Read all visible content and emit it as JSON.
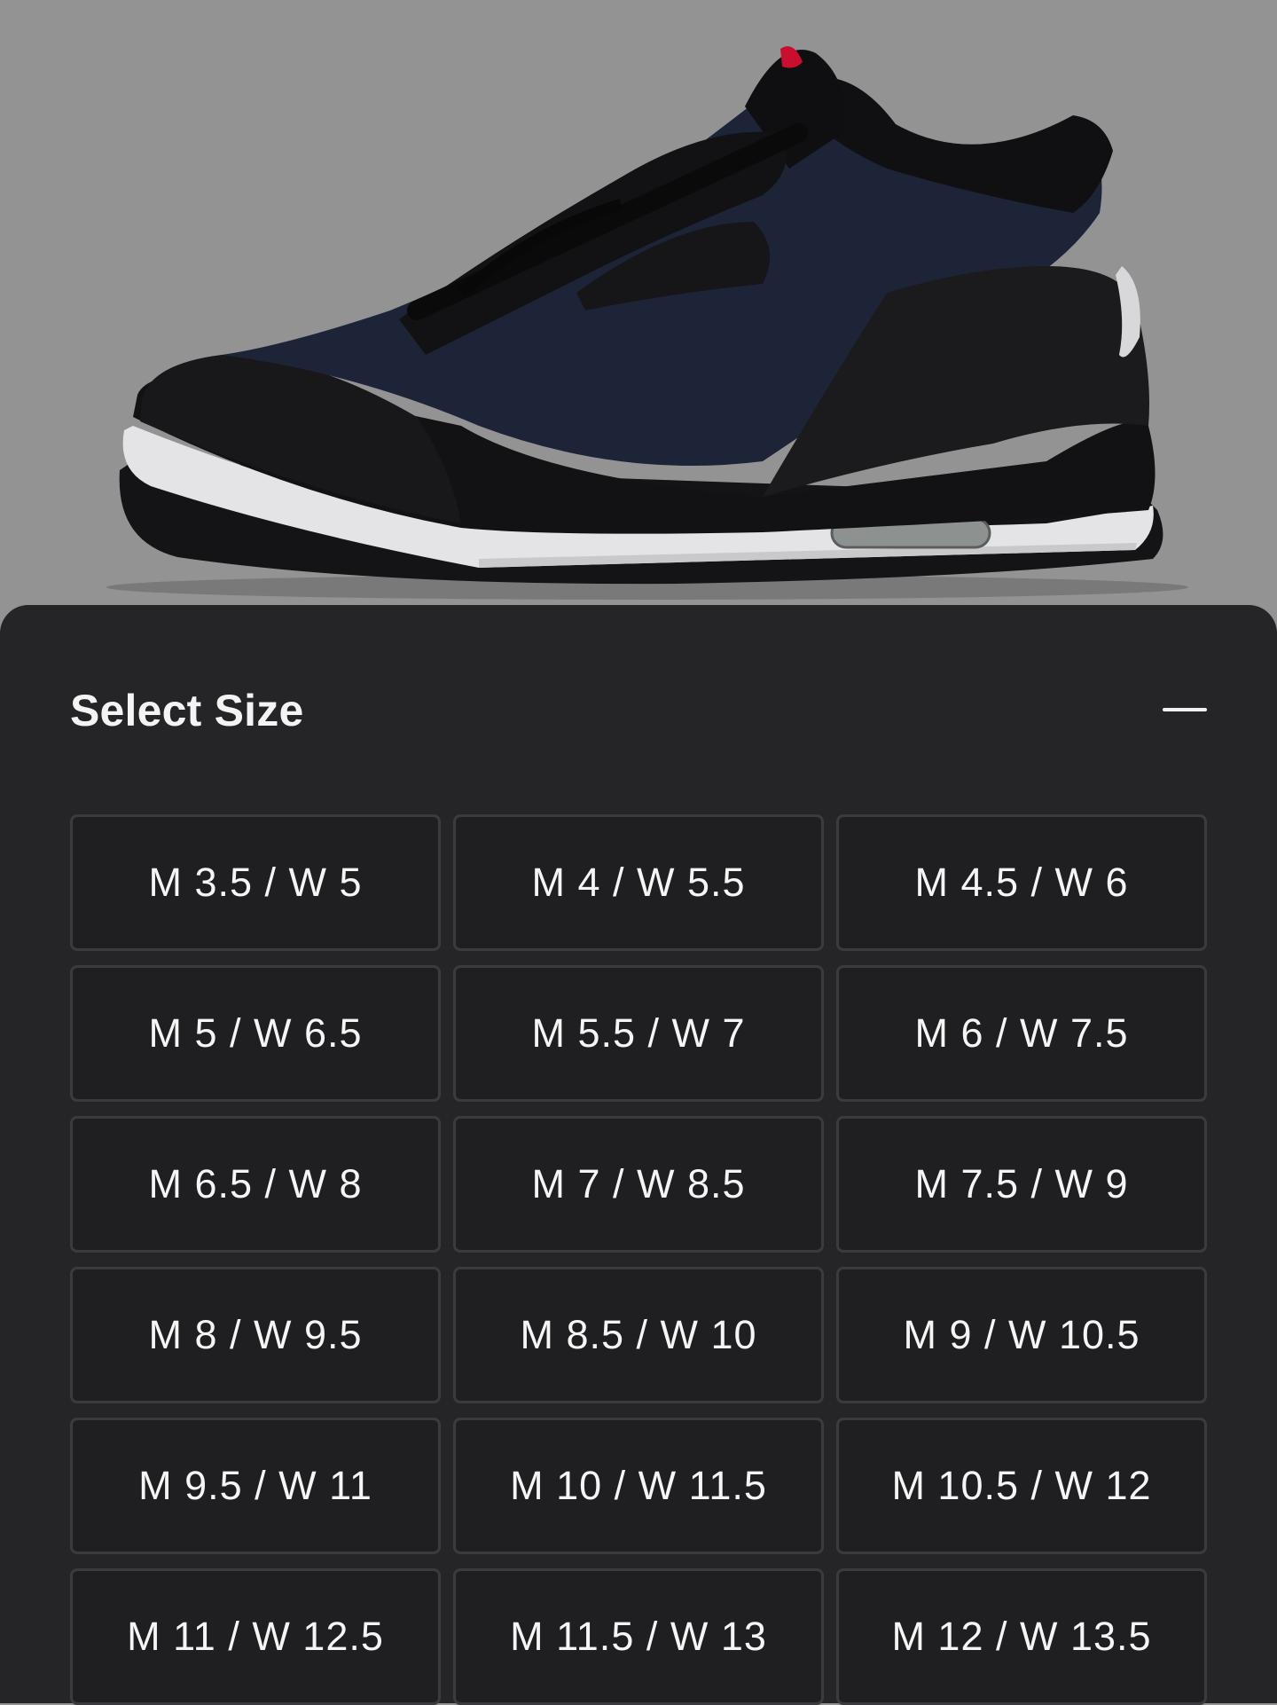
{
  "product": {
    "image_alt": "Air Jordan 3 sneaker in indigo denim with black elephant-print overlays, white midsole and visible air unit",
    "colors": {
      "upper": "#1e2438",
      "overlay": "#121214",
      "sole": "#e4e4e6",
      "accent": "#c8102e",
      "background": "#939393"
    }
  },
  "size_selector": {
    "title": "Select Size",
    "collapse_icon": "minus-icon",
    "sizes": [
      {
        "label": "M 3.5 / W 5"
      },
      {
        "label": "M 4 / W 5.5"
      },
      {
        "label": "M 4.5 / W 6"
      },
      {
        "label": "M 5 / W 6.5"
      },
      {
        "label": "M 5.5 / W 7"
      },
      {
        "label": "M 6 / W 7.5"
      },
      {
        "label": "M 6.5 / W 8"
      },
      {
        "label": "M 7 / W 8.5"
      },
      {
        "label": "M 7.5 / W 9"
      },
      {
        "label": "M 8 / W 9.5"
      },
      {
        "label": "M 8.5 / W 10"
      },
      {
        "label": "M 9 / W 10.5"
      },
      {
        "label": "M 9.5 / W 11"
      },
      {
        "label": "M 10 / W 11.5"
      },
      {
        "label": "M 10.5 / W 12"
      },
      {
        "label": "M 11 / W 12.5"
      },
      {
        "label": "M 11.5 / W 13"
      },
      {
        "label": "M 12 / W 13.5"
      }
    ]
  }
}
